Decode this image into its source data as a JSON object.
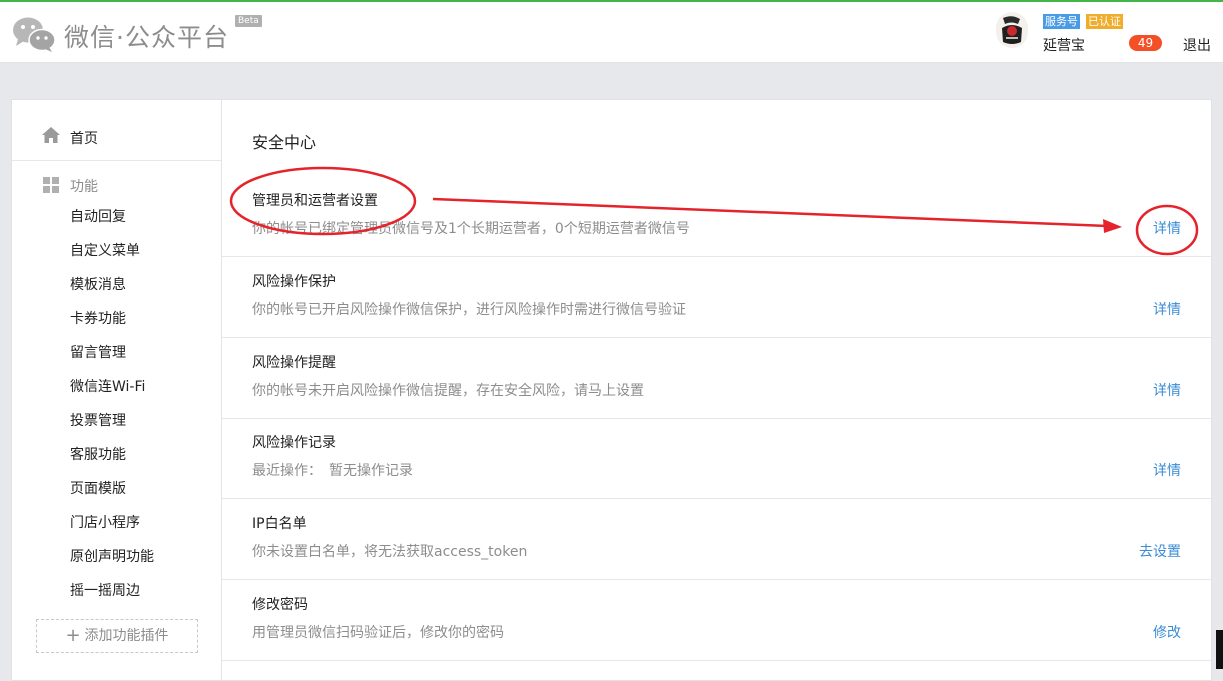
{
  "header": {
    "brand": "微信·公众平台",
    "beta": "Beta",
    "badge_service": "服务号",
    "badge_verified": "已认证",
    "account_name": "延营宝",
    "notification_count": "49",
    "logout": "退出"
  },
  "sidebar": {
    "home": "首页",
    "section_title": "功能",
    "items": [
      {
        "label": "自动回复"
      },
      {
        "label": "自定义菜单"
      },
      {
        "label": "模板消息"
      },
      {
        "label": "卡券功能"
      },
      {
        "label": "留言管理"
      },
      {
        "label": "微信连Wi-Fi"
      },
      {
        "label": "投票管理"
      },
      {
        "label": "客服功能"
      },
      {
        "label": "页面模版"
      },
      {
        "label": "门店小程序"
      },
      {
        "label": "原创声明功能"
      },
      {
        "label": "摇一摇周边"
      }
    ],
    "add_plugin": "添加功能插件"
  },
  "main": {
    "title": "安全中心",
    "rows": [
      {
        "title": "管理员和运营者设置",
        "desc": "你的帐号已绑定管理员微信号及1个长期运营者，0个短期运营者微信号",
        "action": "详情"
      },
      {
        "title": "风险操作保护",
        "desc": "你的帐号已开启风险操作微信保护，进行风险操作时需进行微信号验证",
        "action": "详情"
      },
      {
        "title": "风险操作提醒",
        "desc": "你的帐号未开启风险操作微信提醒，存在安全风险，请马上设置",
        "action": "详情"
      },
      {
        "title": "风险操作记录",
        "desc": "最近操作：　暂无操作记录",
        "action": "详情"
      },
      {
        "title": "IP白名单",
        "desc": "你未设置白名单，将无法获取access_token",
        "action": "去设置"
      },
      {
        "title": "修改密码",
        "desc": "用管理员微信扫码验证后，修改你的密码",
        "action": "修改"
      }
    ]
  },
  "colors": {
    "accent_green": "#44b549",
    "link_blue": "#3b8cd4",
    "annotation_red": "#e5232b",
    "notification_red": "#f35028"
  },
  "icons": [
    "wechat-logo-icon",
    "home-icon",
    "grid-icon",
    "plus-icon"
  ]
}
